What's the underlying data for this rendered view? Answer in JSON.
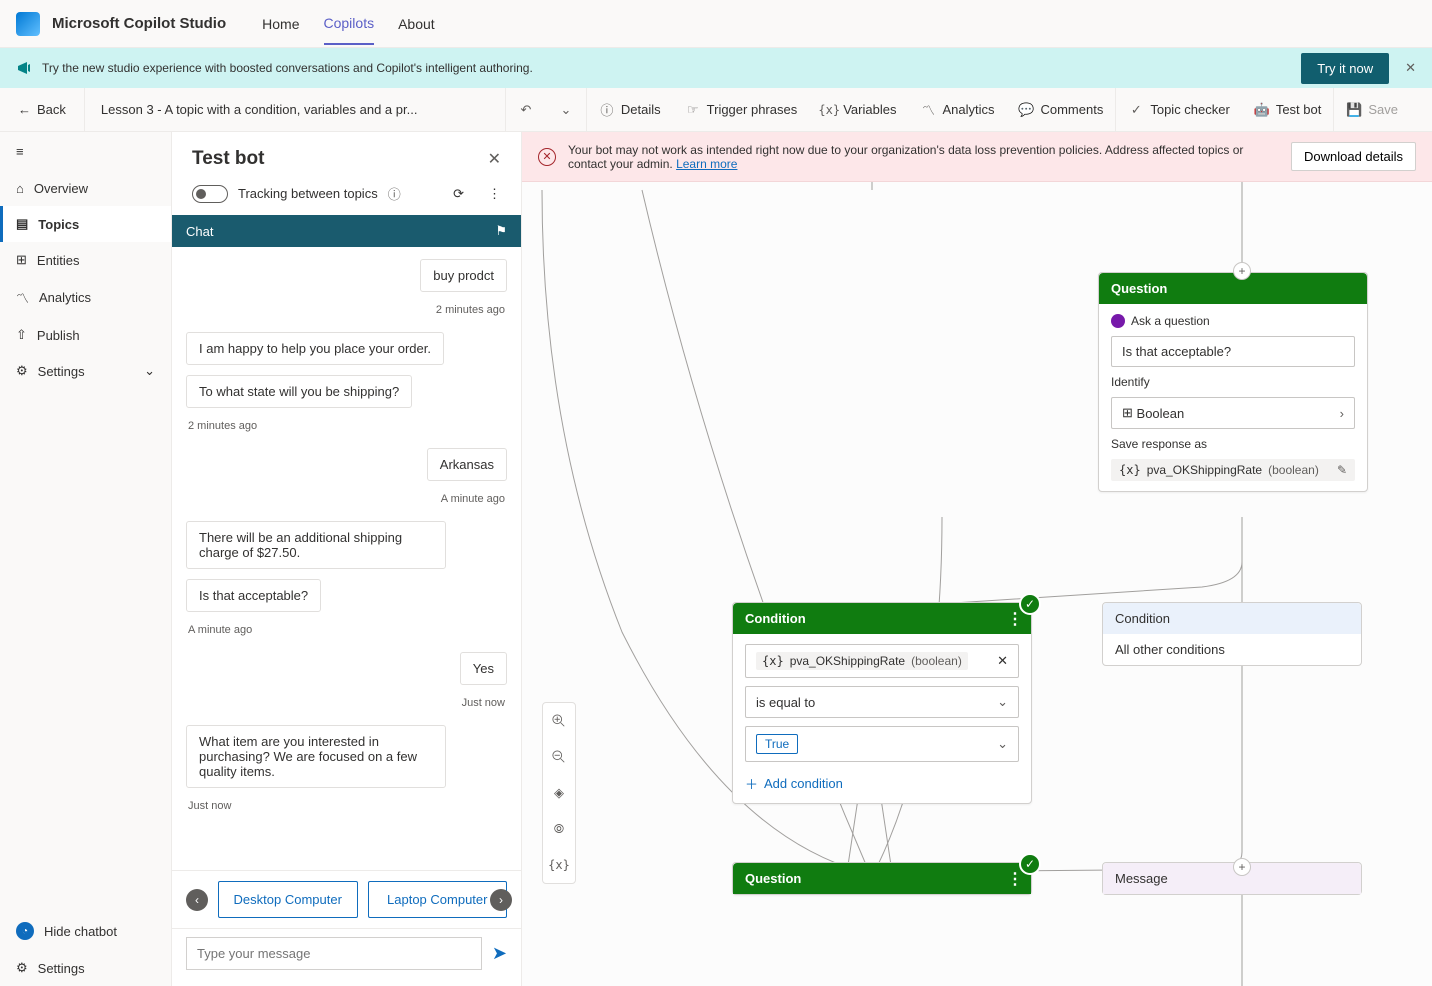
{
  "header": {
    "product": "Microsoft Copilot Studio",
    "nav": {
      "home": "Home",
      "copilots": "Copilots",
      "about": "About"
    }
  },
  "promo": {
    "text": "Try the new studio experience with boosted conversations and Copilot's intelligent authoring.",
    "button": "Try it now"
  },
  "toolbar": {
    "back": "Back",
    "breadcrumb": "Lesson 3 - A topic with a condition, variables and a pr...",
    "details": "Details",
    "trigger": "Trigger phrases",
    "variables": "Variables",
    "analytics": "Analytics",
    "comments": "Comments",
    "topicchecker": "Topic checker",
    "testbot": "Test bot",
    "save": "Save"
  },
  "sidebar": {
    "overview": "Overview",
    "topics": "Topics",
    "entities": "Entities",
    "analytics": "Analytics",
    "publish": "Publish",
    "settings": "Settings",
    "hidechatbot": "Hide chatbot",
    "settings2": "Settings"
  },
  "testbot": {
    "title": "Test bot",
    "tracking": "Tracking between topics",
    "chat_label": "Chat",
    "input_placeholder": "Type your message",
    "messages": {
      "m1": "buy prodct",
      "t1": "2 minutes ago",
      "m2": "I am happy to help you place your order.",
      "m3": "To what state will you be shipping?",
      "t2": "2 minutes ago",
      "m4": "Arkansas",
      "t3": "A minute ago",
      "m5": "There will be an additional shipping charge of $27.50.",
      "m6": "Is that acceptable?",
      "t4": "A minute ago",
      "m7": "Yes",
      "t5": "Just now",
      "m8": "What item are you interested in purchasing? We are focused on a few quality items.",
      "t6": "Just now"
    },
    "suggestions": {
      "s1": "Desktop Computer",
      "s2": "Laptop Computer"
    }
  },
  "dlp": {
    "text": "Your bot may not work as intended right now due to your organization's data loss prevention policies. Address affected topics or contact your admin.",
    "learn": "Learn more",
    "download": "Download details"
  },
  "nodes": {
    "question": {
      "title": "Question",
      "ask": "Ask a question",
      "prompt": "Is that acceptable?",
      "identify": "Identify",
      "identify_value": "Boolean",
      "save_as": "Save response as",
      "var_name": "pva_OKShippingRate",
      "var_type": "(boolean)"
    },
    "condition": {
      "title": "Condition",
      "var_name": "pva_OKShippingRate",
      "var_type": "(boolean)",
      "op": "is equal to",
      "value": "True",
      "add": "Add condition"
    },
    "condition2": {
      "title": "Condition",
      "body": "All other conditions"
    },
    "question2": {
      "title": "Question"
    },
    "message": {
      "title": "Message"
    }
  },
  "zoom": {
    "varlabel": "{x}"
  }
}
